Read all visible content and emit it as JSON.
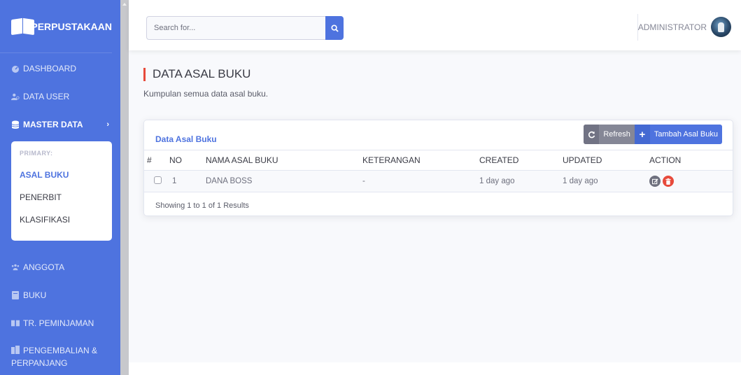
{
  "brand": {
    "name": "PERPUSTAKAAN"
  },
  "sidebar": {
    "items": [
      {
        "label": "DASHBOARD",
        "icon": "dashboard-icon"
      },
      {
        "label": "DATA USER",
        "icon": "users-icon"
      },
      {
        "label": "MASTER DATA",
        "icon": "database-icon",
        "active": true
      },
      {
        "label": "ANGGOTA",
        "icon": "members-icon"
      },
      {
        "label": "BUKU",
        "icon": "book-icon"
      },
      {
        "label": "TR. PEMINJAMAN",
        "icon": "loan-icon"
      },
      {
        "label": "PENGEMBALIAN & PERPANJANG",
        "icon": "return-icon"
      }
    ],
    "submenu": {
      "header": "PRIMARY:",
      "items": [
        "ASAL BUKU",
        "PENERBIT",
        "KLASIFIKASI"
      ],
      "active": "ASAL BUKU"
    }
  },
  "search": {
    "placeholder": "Search for..."
  },
  "user": {
    "name": "ADMINISTRATOR"
  },
  "page": {
    "title": "DATA ASAL BUKU",
    "subtitle": "Kumpulan semua data asal buku."
  },
  "card": {
    "title": "Data Asal Buku",
    "refresh_label": "Refresh",
    "add_label": "Tambah Asal Buku",
    "columns": [
      "#",
      "NO",
      "NAMA ASAL BUKU",
      "KETERANGAN",
      "CREATED",
      "UPDATED",
      "ACTION"
    ],
    "rows": [
      {
        "no": "1",
        "nama": "DANA BOSS",
        "keterangan": "-",
        "created": "1 day ago",
        "updated": "1 day ago"
      }
    ],
    "footer": "Showing 1 to 1 of 1 Results"
  },
  "colors": {
    "primary": "#4e73df",
    "danger": "#e74a3b",
    "secondary": "#858796"
  }
}
